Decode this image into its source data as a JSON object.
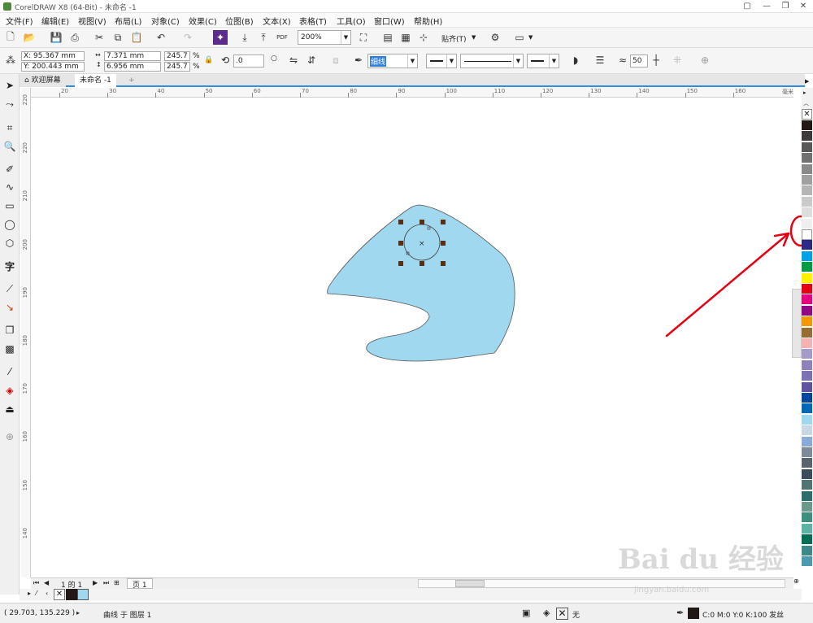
{
  "window": {
    "title": "CorelDRAW X8 (64-Bit) - 未命名 -1",
    "min": "—",
    "max": "❐",
    "close": "✕"
  },
  "menu": [
    "文件(F)",
    "编辑(E)",
    "视图(V)",
    "布局(L)",
    "对象(C)",
    "效果(C)",
    "位图(B)",
    "文本(X)",
    "表格(T)",
    "工具(O)",
    "窗口(W)",
    "帮助(H)"
  ],
  "standard": {
    "zoom": "200%",
    "snap_label": "贴齐(T)",
    "pdf_label": "PDF"
  },
  "property": {
    "x": "X: 95.367 mm",
    "y": "Y: 200.443 mm",
    "w": "7.371 mm",
    "h": "6.956 mm",
    "sx": "245.7",
    "sy": "245.7",
    "pct": "%",
    "rotation": ".0",
    "outline_width": "细线",
    "smooth": "50"
  },
  "tabs": {
    "welcome": "欢迎屏幕",
    "doc": "未命名 -1",
    "add": "+"
  },
  "ruler": {
    "h_ticks": [
      "20",
      "30",
      "40",
      "50",
      "60",
      "70",
      "80",
      "90",
      "100",
      "110",
      "120",
      "130",
      "140",
      "150",
      "160"
    ],
    "unit": "毫米",
    "v_ticks": [
      "220",
      "220",
      "210",
      "200",
      "190",
      "180",
      "170",
      "160",
      "150",
      "140"
    ]
  },
  "pager": {
    "page_info": "1 的 1",
    "page_tab": "页 1"
  },
  "status": {
    "coords": "( 29.703, 135.229 )",
    "object_info": "曲线 于 图层 1",
    "fill_none": "无",
    "outline_info": "C:0 M:0 Y:0 K:100 发丝"
  },
  "palette_colors": [
    "#221815",
    "#3e3a39",
    "#595757",
    "#727171",
    "#898989",
    "#9fa0a0",
    "#b5b5b6",
    "#c9caca",
    "#dcdddd",
    "#efefef",
    "#ffffff",
    "#2b2a87",
    "#00a0e9",
    "#009944",
    "#fff100",
    "#e60012",
    "#e4007f",
    "#920783",
    "#f39800",
    "#996c33",
    "#f5b2b2",
    "#a59aca",
    "#8f82bc",
    "#7a72b5",
    "#5f52a0",
    "#00479d",
    "#0068b7",
    "#a0d8ef",
    "#c7d7e4",
    "#88abda",
    "#7c8a99",
    "#596271",
    "#3c4c5b",
    "#4f7574",
    "#2d6f6c",
    "#6a9a8c",
    "#3e8e7e",
    "#5bb3a3",
    "#006e54",
    "#3b8a8a",
    "#4c9ab0"
  ],
  "doc_colors": [
    "#221815",
    "#a0d8ef"
  ],
  "watermark": {
    "brand": "Bai du 经验",
    "url": "jingyan.baidu.com"
  },
  "shape": {
    "fill": "#a0d8ef",
    "outline": "#555555"
  },
  "annotation": {
    "color": "#e60012"
  }
}
